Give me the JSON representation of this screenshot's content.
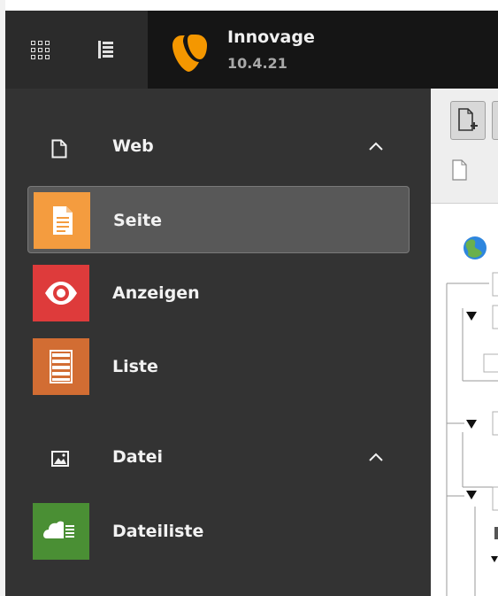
{
  "topbar": {
    "site_name": "Innovage",
    "version": "10.4.21"
  },
  "menu": {
    "groups": [
      {
        "label": "Web",
        "icon": "page-icon",
        "modules": [
          {
            "label": "Seite",
            "icon": "page-module-icon",
            "color": "#f49c3f",
            "active": true
          },
          {
            "label": "Anzeigen",
            "icon": "eye-icon",
            "color": "#de3b3b",
            "active": false
          },
          {
            "label": "Liste",
            "icon": "list-module-icon",
            "color": "#d26d33",
            "active": false
          }
        ]
      },
      {
        "label": "Datei",
        "icon": "image-icon",
        "modules": [
          {
            "label": "Dateiliste",
            "icon": "cloud-files-icon",
            "color": "#4a8f34",
            "active": false
          }
        ]
      }
    ]
  },
  "colors": {
    "topbar": "#151515",
    "sidebar": "#333333",
    "active_module": "#585858",
    "typo3_orange": "#f49700"
  }
}
